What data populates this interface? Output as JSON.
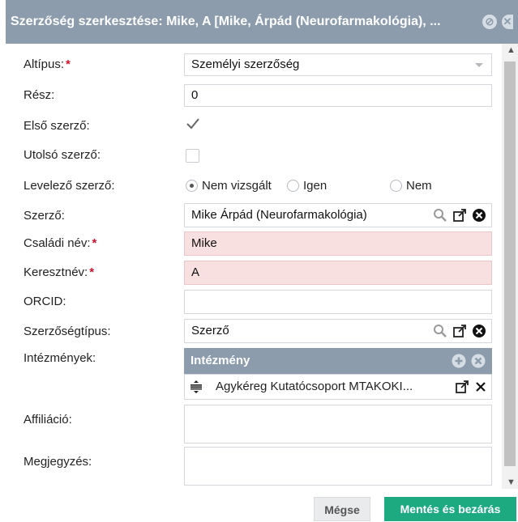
{
  "dialog": {
    "title": "Szerzőség szerkesztése: Mike, A [Mike, Árpád (Neurofarmakológia), ...",
    "header_icons": [
      "cancel-circle-icon",
      "close-circle-icon"
    ]
  },
  "form": {
    "subtype": {
      "label": "Altípus:",
      "value": "Személyi szerzőség",
      "required": "*"
    },
    "part": {
      "label": "Rész:",
      "value": "0"
    },
    "first_author": {
      "label": "Első szerző:",
      "checked": "true"
    },
    "last_author": {
      "label": "Utolsó szerző:",
      "checked": "false"
    },
    "corresponding": {
      "label": "Levelező szerző:",
      "options": [
        "Nem vizsgált",
        "Igen",
        "Nem"
      ],
      "selected": "Nem vizsgált"
    },
    "author": {
      "label": "Szerző:",
      "value": "Mike Árpád (Neurofarmakológia)"
    },
    "family_name": {
      "label": "Családi név:",
      "value": "Mike",
      "required": "*"
    },
    "given_name": {
      "label": "Keresztnév:",
      "value": "A",
      "required": "*"
    },
    "orcid": {
      "label": "ORCID:",
      "value": ""
    },
    "authorship_type": {
      "label": "Szerzőségtípus:",
      "value": "Szerző"
    },
    "institutions": {
      "label": "Intézmények:",
      "header": "Intézmény",
      "items": [
        "Agykéreg Kutatócsoport MTAKOKI..."
      ]
    },
    "affiliation": {
      "label": "Affiliáció:",
      "value": ""
    },
    "note": {
      "label": "Megjegyzés:",
      "value": ""
    }
  },
  "footer": {
    "cancel_label": "Mégse",
    "save_label": "Mentés és bezárás"
  },
  "colors": {
    "titlebar": "#8c9cac",
    "invalid_bg": "#f8dfe0",
    "required": "#d0112b",
    "save_button": "#1daa80"
  }
}
